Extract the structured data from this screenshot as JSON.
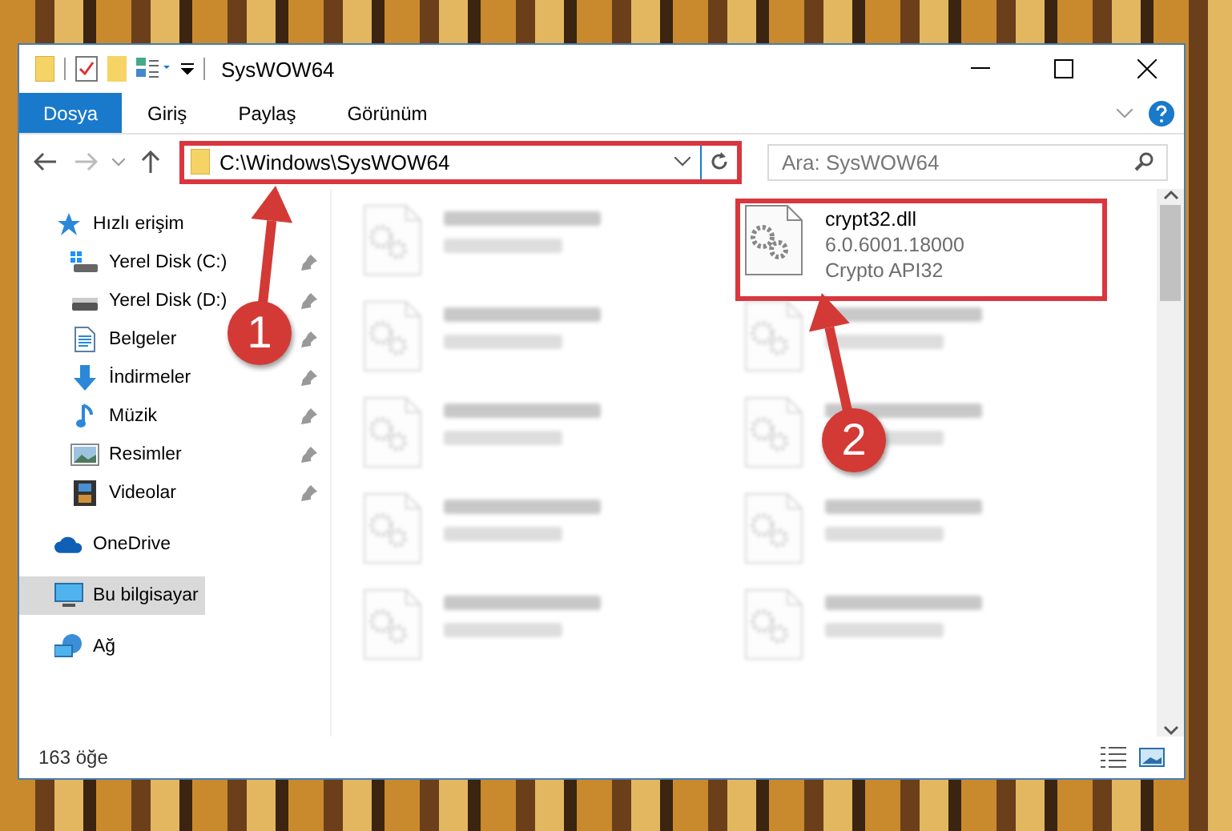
{
  "window": {
    "title": "SysWOW64"
  },
  "ribbon_tabs": [
    {
      "label": "Dosya",
      "selected": true
    },
    {
      "label": "Giriş",
      "selected": false
    },
    {
      "label": "Paylaş",
      "selected": false
    },
    {
      "label": "Görünüm",
      "selected": false
    }
  ],
  "address": {
    "path": "C:\\Windows\\SysWOW64",
    "highlighted": true
  },
  "search": {
    "placeholder": "Ara: SysWOW64"
  },
  "sidebar": {
    "items": [
      {
        "label": "Hızlı erişim",
        "kind": "star",
        "selected": false,
        "children": [
          {
            "label": "Yerel Disk (C:)",
            "kind": "system-drive",
            "pinned": true,
            "selected": false
          },
          {
            "label": "Yerel Disk (D:)",
            "kind": "drive",
            "pinned": true,
            "selected": false
          },
          {
            "label": "Belgeler",
            "kind": "document",
            "pinned": true,
            "selected": false
          },
          {
            "label": "İndirmeler",
            "kind": "download",
            "pinned": true,
            "selected": false
          },
          {
            "label": "Müzik",
            "kind": "music",
            "pinned": true,
            "selected": false
          },
          {
            "label": "Resimler",
            "kind": "picture",
            "pinned": true,
            "selected": false
          },
          {
            "label": "Videolar",
            "kind": "video",
            "pinned": true,
            "selected": false
          }
        ]
      },
      {
        "label": "OneDrive",
        "kind": "cloud",
        "selected": false
      },
      {
        "label": "Bu bilgisayar",
        "kind": "computer",
        "selected": true
      },
      {
        "label": "Ağ",
        "kind": "network",
        "selected": false
      }
    ]
  },
  "files": [
    {
      "blurred": true,
      "highlighted": false
    },
    {
      "lines": [
        "crypt32.dll",
        "6.0.6001.18000",
        "Crypto API32"
      ],
      "blurred": false,
      "highlighted": true
    },
    {
      "blurred": true,
      "highlighted": false
    },
    {
      "blurred": true,
      "highlighted": false
    },
    {
      "blurred": true,
      "highlighted": false
    },
    {
      "blurred": true,
      "highlighted": false
    },
    {
      "blurred": true,
      "highlighted": false
    },
    {
      "blurred": true,
      "highlighted": false
    },
    {
      "blurred": true,
      "highlighted": false
    },
    {
      "blurred": true,
      "highlighted": false
    }
  ],
  "callouts": [
    {
      "number": "1"
    },
    {
      "number": "2"
    }
  ],
  "status_bar": {
    "count": "163 öğe"
  }
}
